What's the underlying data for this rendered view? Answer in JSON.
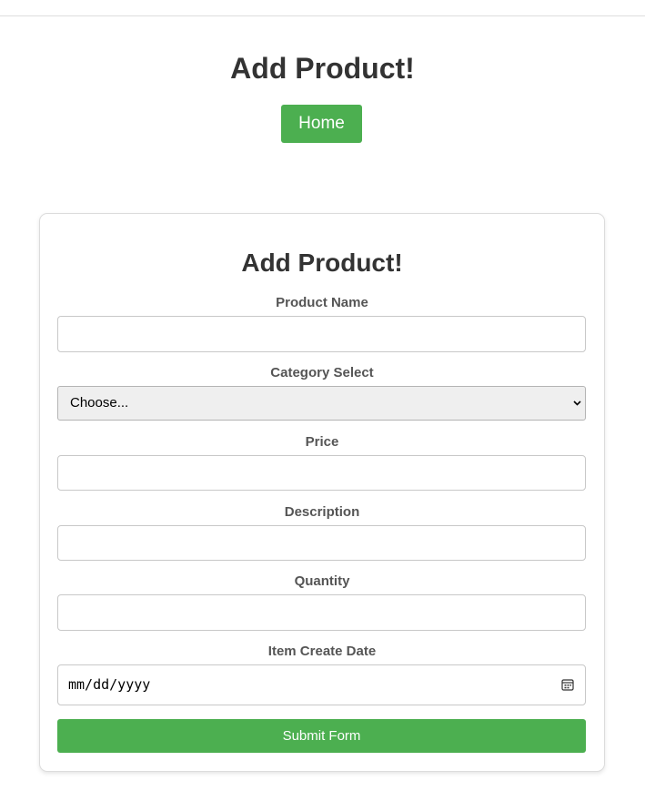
{
  "header": {
    "title": "Add Product!",
    "home_label": "Home"
  },
  "form": {
    "title": "Add Product!",
    "product_name": {
      "label": "Product Name",
      "value": ""
    },
    "category": {
      "label": "Category Select",
      "selected": "Choose..."
    },
    "price": {
      "label": "Price",
      "value": ""
    },
    "description": {
      "label": "Description",
      "value": ""
    },
    "quantity": {
      "label": "Quantity",
      "value": ""
    },
    "create_date": {
      "label": "Item Create Date",
      "placeholder": "mm/dd/yyyy"
    },
    "submit_label": "Submit Form"
  },
  "icons": {
    "select": "chevron-down-icon",
    "date": "calendar-icon"
  },
  "colors": {
    "accent": "#4caf50",
    "heading": "#333333",
    "label": "#555555"
  }
}
